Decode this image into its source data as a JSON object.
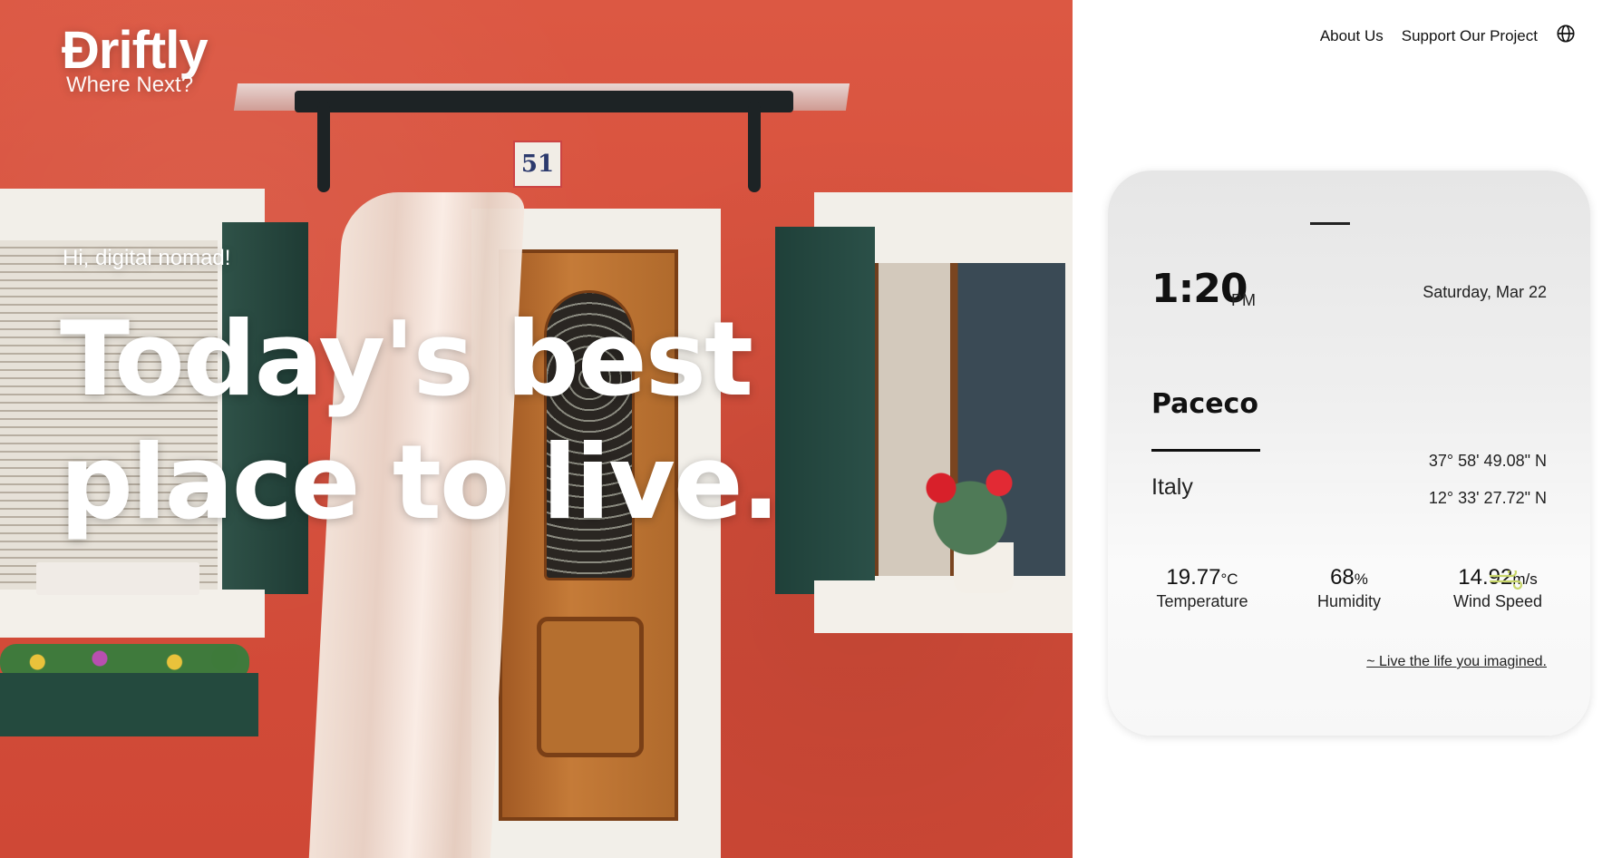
{
  "brand": {
    "name": "Đriftly",
    "tagline": "Where Next?"
  },
  "nav": {
    "about": "About Us",
    "support": "Support Our Project"
  },
  "hero": {
    "greeting": "Hi, digital nomad!",
    "headline_line1": "Today's best",
    "headline_line2": "place to live.",
    "house_number": "51"
  },
  "card": {
    "time": "1:20",
    "ampm": "PM",
    "date": "Saturday, Mar 22",
    "city": "Paceco",
    "country": "Italy",
    "latitude": "37° 58' 49.08\" N",
    "longitude": "12° 33' 27.72\" N",
    "temperature": {
      "value": "19.77",
      "unit": "°C",
      "label": "Temperature"
    },
    "humidity": {
      "value": "68",
      "unit": "%",
      "label": "Humidity"
    },
    "wind": {
      "value": "14.92",
      "unit": "m/s",
      "label": "Wind Speed"
    },
    "tagline": "~ Live the life you imagined."
  },
  "icons": {
    "language": "globe-icon",
    "temperature": "sun-icon",
    "humidity": "droplet-icon",
    "wind": "wind-icon"
  },
  "colors": {
    "accent_yellow": "#ffd646",
    "accent_blue": "#6ec3ec",
    "wall_red": "#d9533f"
  }
}
